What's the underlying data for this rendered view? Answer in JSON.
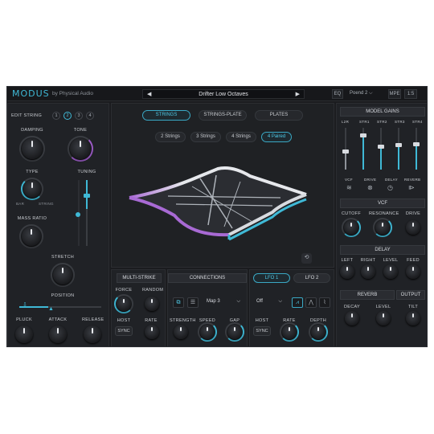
{
  "app": {
    "logo": "MODUS",
    "subtitle": "by Physical Audio",
    "preset_name": "Drifter Low Octaves",
    "eq_label": "EQ",
    "preset_slot": "Poend 2",
    "btn_a": "MPE",
    "btn_b": "1:5"
  },
  "left": {
    "edit_string_label": "EDIT STRING",
    "string_numbers": [
      "1",
      "2",
      "3",
      "4"
    ],
    "active_string": 2,
    "damping": "DAMPING",
    "tone": "TONE",
    "type": "TYPE",
    "type_left": "BAR",
    "type_right": "STRING",
    "tuning": "TUNING",
    "mass_ratio": "MASS RATIO",
    "stretch": "STRETCH",
    "position": "POSITION",
    "pluck": "PLUCK",
    "attack": "ATTACK",
    "release": "RELEASE"
  },
  "center": {
    "mode_tabs": [
      "STRINGS",
      "STRINGS-PLATE",
      "PLATES"
    ],
    "active_mode": 0,
    "count_tabs": [
      "2 Strings",
      "3 Strings",
      "4 Strings",
      "4 Paired"
    ],
    "active_count": 3
  },
  "multistrike": {
    "title": "MULTI-STRIKE",
    "force": "FORCE",
    "random": "RANDOM",
    "host": "HOST",
    "rate": "RATE",
    "sync": "SYNC"
  },
  "connections": {
    "title": "CONNECTIONS",
    "map": "Map 3",
    "strength": "STRENGTH",
    "speed": "SPEED",
    "gap": "GAP"
  },
  "lfo": {
    "tab1": "LFO 1",
    "tab2": "LFO 2",
    "mode": "Off",
    "host": "HOST",
    "rate": "RATE",
    "depth": "DEPTH",
    "sync": "SYNC"
  },
  "right": {
    "model_gains": "MODEL GAINS",
    "gain_labels": [
      "L2R",
      "STR1",
      "STR2",
      "STR3",
      "STR4"
    ],
    "gain_levels": [
      0.45,
      0.82,
      0.55,
      0.6,
      0.62
    ],
    "mod_labels": [
      "VCF",
      "DRIVE",
      "DELAY",
      "REVERB"
    ],
    "vcf": "VCF",
    "cutoff": "CUTOFF",
    "resonance": "RESONANCE",
    "drive": "DRIVE",
    "delay": "DELAY",
    "left": "LEFT",
    "right_lbl": "RIGHT",
    "level": "LEVEL",
    "feed": "FEED",
    "reverb": "REVERB",
    "output": "OUTPUT",
    "decay": "DECAY",
    "rev_level": "LEVEL",
    "tilt": "TILT"
  }
}
